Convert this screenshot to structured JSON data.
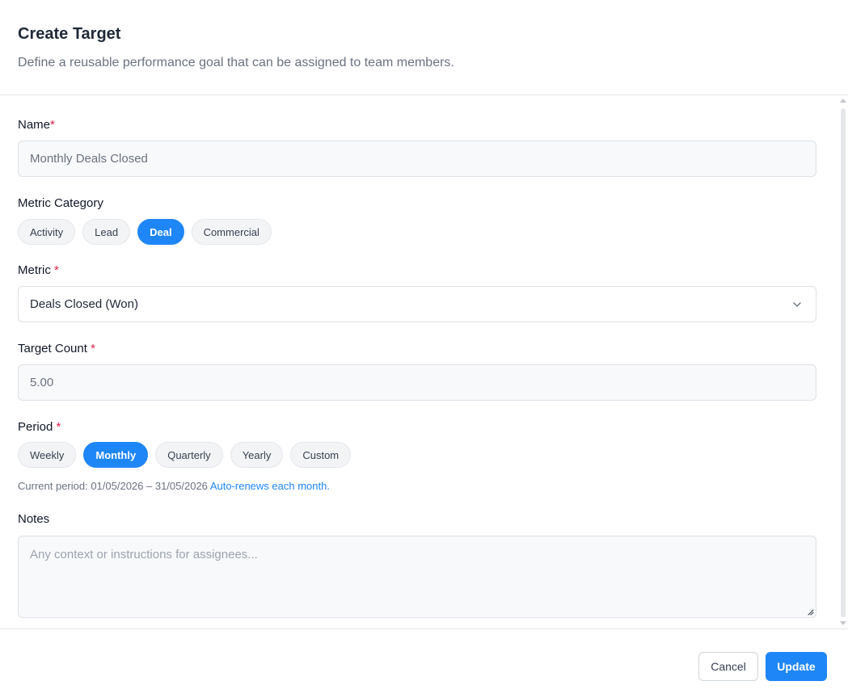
{
  "header": {
    "title": "Create Target",
    "subtitle": "Define a reusable performance goal that can be assigned to team members."
  },
  "form": {
    "name": {
      "label": "Name",
      "required": "*",
      "placeholder": "Monthly Deals Closed"
    },
    "metric_category": {
      "label": "Metric Category",
      "options": [
        "Activity",
        "Lead",
        "Deal",
        "Commercial"
      ],
      "selected": "Deal"
    },
    "metric": {
      "label": "Metric",
      "required": "*",
      "value": "Deals Closed (Won)"
    },
    "target_count": {
      "label": "Target Count",
      "required": "*",
      "placeholder": "5.00"
    },
    "period": {
      "label": "Period",
      "required": "*",
      "options": [
        "Weekly",
        "Monthly",
        "Quarterly",
        "Yearly",
        "Custom"
      ],
      "selected": "Monthly",
      "current_period": "Current period: 01/05/2026 – 31/05/2026",
      "renew_note": "Auto-renews each month."
    },
    "notes": {
      "label": "Notes",
      "placeholder": "Any context or instructions for assignees..."
    }
  },
  "footer": {
    "cancel_label": "Cancel",
    "update_label": "Update"
  },
  "colors": {
    "accent": "#1f86f7",
    "required": "#e11d48"
  },
  "icons": {
    "metric_dropdown": "chevron-down-icon",
    "notes_resize": "resize-handle-icon"
  }
}
